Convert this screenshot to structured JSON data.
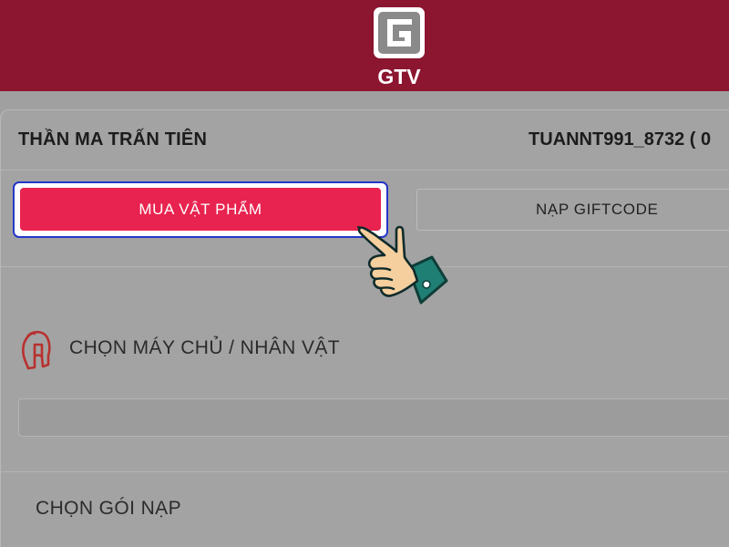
{
  "header": {
    "logo_text": "GTV",
    "brand_color": "#8c1530"
  },
  "panel": {
    "game_title": "THẦN MA TRẤN TIÊN",
    "account": "TUANNT991_8732 ( 0"
  },
  "tabs": {
    "buy_items": "MUA VẬT PHẨM",
    "giftcode": "NẠP GIFTCODE"
  },
  "server_section": {
    "label": "CHỌN MÁY CHỦ / NHÂN VẬT",
    "icon": "spartan-helmet-icon",
    "selected_value": ""
  },
  "package_section": {
    "label": "CHỌN GÓI NẠP"
  },
  "overlay": {
    "pointer": "pointing-hand-icon"
  },
  "colors": {
    "accent": "#e8234f",
    "focus_outline": "#2636c9"
  }
}
